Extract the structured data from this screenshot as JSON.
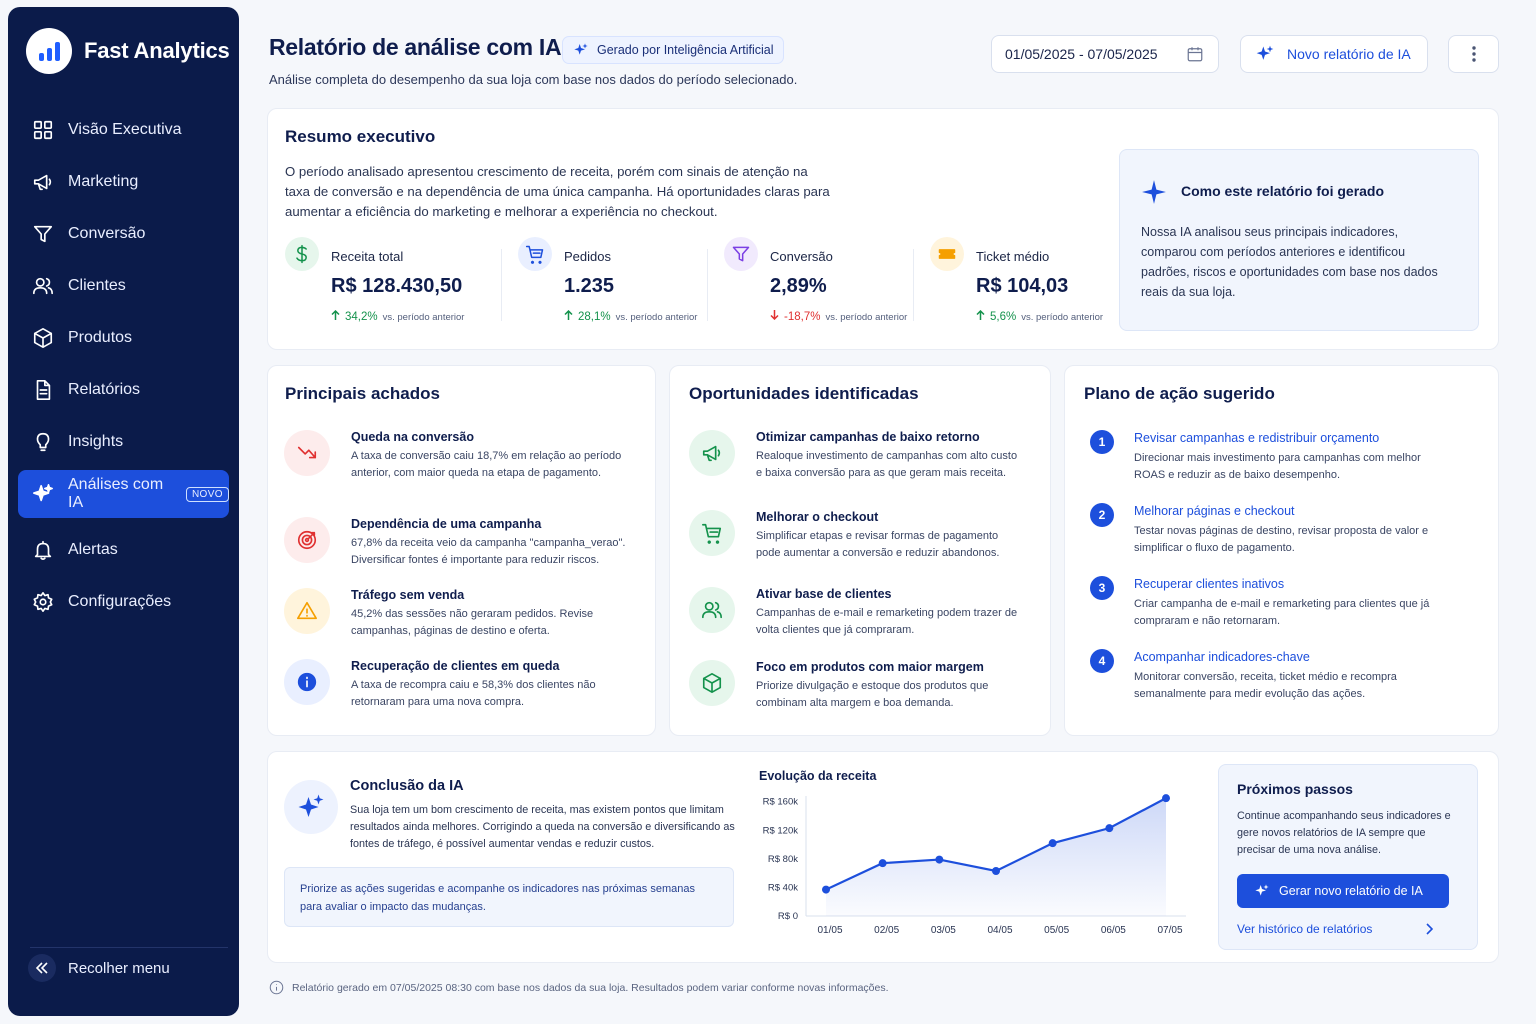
{
  "brand": {
    "name": "Fast Analytics"
  },
  "nav": [
    {
      "label": "Visão Executiva",
      "icon": "grid-icon"
    },
    {
      "label": "Marketing",
      "icon": "megaphone-icon"
    },
    {
      "label": "Conversão",
      "icon": "funnel-icon"
    },
    {
      "label": "Clientes",
      "icon": "users-icon"
    },
    {
      "label": "Produtos",
      "icon": "box-icon"
    },
    {
      "label": "Relatórios",
      "icon": "document-icon"
    },
    {
      "label": "Insights",
      "icon": "lightbulb-icon"
    },
    {
      "label": "Análises com IA",
      "icon": "sparkle-icon",
      "badge": "NOVO",
      "active": true
    },
    {
      "label": "Alertas",
      "icon": "bell-icon"
    },
    {
      "label": "Configurações",
      "icon": "gear-icon"
    }
  ],
  "collapse_label": "Recolher menu",
  "header": {
    "title": "Relatório de análise com IA",
    "ai_badge": "Gerado por Inteligência Artificial",
    "subtitle": "Análise completa do desempenho da sua loja com base nos dados do período selecionado.",
    "date_range": "01/05/2025 - 07/05/2025",
    "new_report_label": "Novo relatório de IA"
  },
  "summary": {
    "title": "Resumo executivo",
    "text": "O período analisado apresentou crescimento de receita, porém com sinais de atenção na taxa de conversão e na dependência de uma única campanha. Há oportunidades claras para aumentar a eficiência do marketing e melhorar a experiência no checkout.",
    "kpis": [
      {
        "label": "Receita total",
        "value": "R$ 128.430,50",
        "delta": "34,2%",
        "direction": "up",
        "vs": "vs. período anterior",
        "icon": "dollar-icon",
        "color": "#14924c",
        "bg": "#e6f6ec"
      },
      {
        "label": "Pedidos",
        "value": "1.235",
        "delta": "28,1%",
        "direction": "up",
        "vs": "vs. período anterior",
        "icon": "cart-icon",
        "color": "#1d4fdc",
        "bg": "#e9efff"
      },
      {
        "label": "Conversão",
        "value": "2,89%",
        "delta": "-18,7%",
        "direction": "down",
        "vs": "vs. período anterior",
        "icon": "funnel-icon",
        "color": "#7b3fe4",
        "bg": "#f1eafd"
      },
      {
        "label": "Ticket médio",
        "value": "R$ 104,03",
        "delta": "5,6%",
        "direction": "up",
        "vs": "vs. período anterior",
        "icon": "ticket-icon",
        "color": "#f59f00",
        "bg": "#fff4dc"
      }
    ],
    "how": {
      "title": "Como este relatório foi gerado",
      "text": "Nossa IA analisou seus principais indicadores, comparou com períodos anteriores e identificou padrões, riscos e oportunidades com base nos dados reais da sua loja."
    }
  },
  "findings": {
    "title": "Principais achados",
    "items": [
      {
        "title": "Queda na conversão",
        "desc": "A taxa de conversão caiu 18,7% em relação ao período anterior, com maior queda na etapa de pagamento.",
        "icon": "trend-down-icon",
        "color": "#e03131",
        "bg": "#fdecec"
      },
      {
        "title": "Dependência de uma campanha",
        "desc": "67,8% da receita veio da campanha \"campanha_verao\". Diversificar fontes é importante para reduzir riscos.",
        "icon": "target-icon",
        "color": "#e03131",
        "bg": "#fdecec"
      },
      {
        "title": "Tráfego sem venda",
        "desc": "45,2% das sessões não geraram pedidos. Revise campanhas, páginas de destino e oferta.",
        "icon": "warning-icon",
        "color": "#f59f00",
        "bg": "#fff4dc"
      },
      {
        "title": "Recuperação de clientes em queda",
        "desc": "A taxa de recompra caiu e 58,3% dos clientes não retornaram para uma nova compra.",
        "icon": "info-icon",
        "color": "#1d4fdc",
        "bg": "#e9efff"
      }
    ]
  },
  "opportunities": {
    "title": "Oportunidades identificadas",
    "items": [
      {
        "title": "Otimizar campanhas de baixo retorno",
        "desc": "Realoque investimento de campanhas com alto custo e baixa conversão para as que geram mais receita.",
        "icon": "megaphone-icon",
        "color": "#14924c",
        "bg": "#e6f6ec"
      },
      {
        "title": "Melhorar o checkout",
        "desc": "Simplificar etapas e revisar formas de pagamento pode aumentar a conversão e reduzir abandonos.",
        "icon": "cart-icon",
        "color": "#14924c",
        "bg": "#e6f6ec"
      },
      {
        "title": "Ativar base de clientes",
        "desc": "Campanhas de e-mail e remarketing podem trazer de volta clientes que já compraram.",
        "icon": "users-icon",
        "color": "#14924c",
        "bg": "#e6f6ec"
      },
      {
        "title": "Foco em produtos com maior margem",
        "desc": "Priorize divulgação e estoque dos produtos que combinam alta margem e boa demanda.",
        "icon": "box-icon",
        "color": "#14924c",
        "bg": "#e6f6ec"
      }
    ]
  },
  "plan": {
    "title": "Plano de ação sugerido",
    "items": [
      {
        "num": "1",
        "title": "Revisar campanhas e redistribuir orçamento",
        "desc": "Direcionar mais investimento para campanhas com melhor ROAS e reduzir as de baixo desempenho."
      },
      {
        "num": "2",
        "title": "Melhorar páginas e checkout",
        "desc": "Testar novas páginas de destino, revisar proposta de valor e simplificar o fluxo de pagamento."
      },
      {
        "num": "3",
        "title": "Recuperar clientes inativos",
        "desc": "Criar campanha de e-mail e remarketing para clientes que já compraram e não retornaram."
      },
      {
        "num": "4",
        "title": "Acompanhar indicadores-chave",
        "desc": "Monitorar conversão, receita, ticket médio e recompra semanalmente para medir evolução das ações."
      }
    ]
  },
  "conclusion": {
    "title": "Conclusão da IA",
    "text": "Sua loja tem um bom crescimento de receita, mas existem pontos que limitam resultados ainda melhores. Corrigindo a queda na conversão e diversificando as fontes de tráfego, é possível aumentar vendas e reduzir custos.",
    "note": "Priorize as ações sugeridas e acompanhe os indicadores nas próximas semanas para avaliar o impacto das mudanças."
  },
  "chart_data": {
    "type": "area",
    "title": "Evolução da receita",
    "categories": [
      "01/05",
      "02/05",
      "03/05",
      "04/05",
      "05/05",
      "06/05",
      "07/05"
    ],
    "values": [
      37000,
      74000,
      79000,
      63000,
      102000,
      123000,
      165000
    ],
    "y_ticks": [
      "R$ 0",
      "R$ 40k",
      "R$ 80k",
      "R$ 120k",
      "R$ 160k"
    ],
    "ylim": [
      0,
      168000
    ],
    "color": "#1d4fdc"
  },
  "next_steps": {
    "title": "Próximos passos",
    "text": "Continue acompanhando seus indicadores e gere novos relatórios de IA sempre que precisar de uma nova análise.",
    "button": "Gerar novo relatório de IA",
    "link": "Ver histórico de relatórios"
  },
  "footer": "Relatório gerado em 07/05/2025 08:30 com base nos dados da sua loja. Resultados podem variar conforme novas informações."
}
